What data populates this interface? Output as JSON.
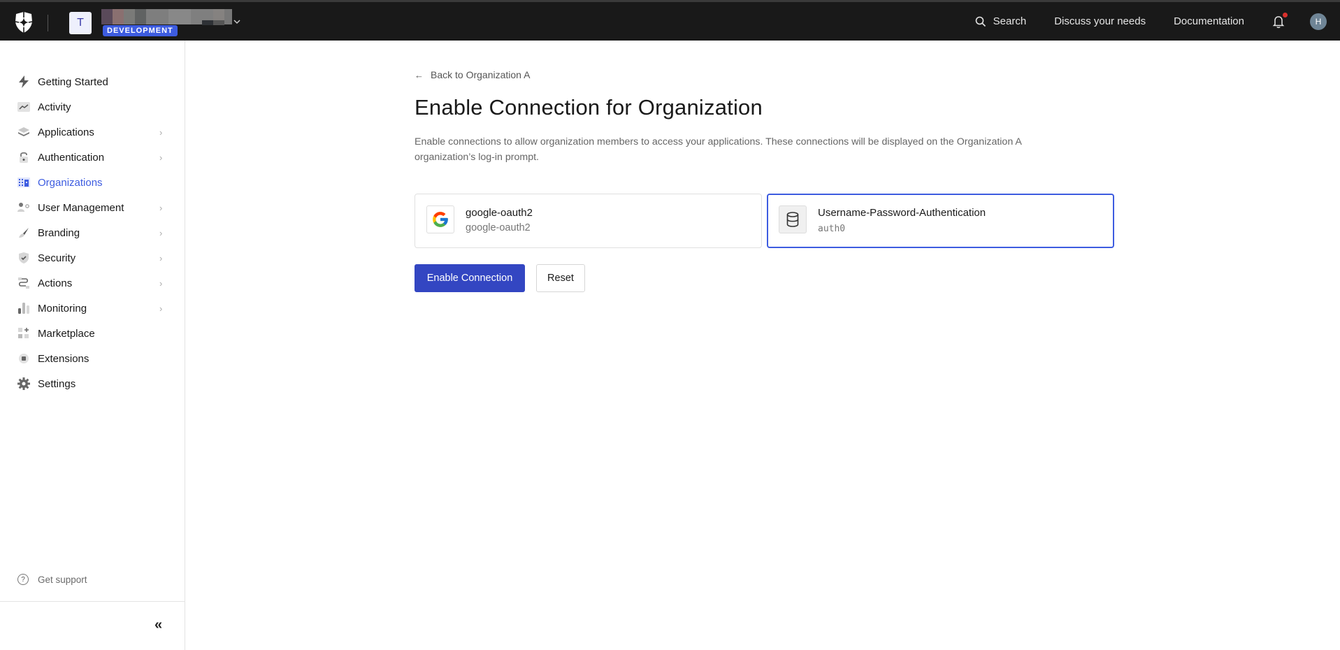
{
  "topbar": {
    "tenant_initial": "T",
    "environment_badge": "DEVELOPMENT",
    "links": {
      "search": "Search",
      "discuss": "Discuss your needs",
      "documentation": "Documentation"
    },
    "avatar_initial": "H",
    "colors": {
      "badge": "#3d5ce0",
      "notification_dot": "#d9302c"
    }
  },
  "sidebar": {
    "items": [
      {
        "label": "Getting Started",
        "icon": "lightning-icon",
        "has_chevron": false
      },
      {
        "label": "Activity",
        "icon": "activity-chart-icon",
        "has_chevron": false
      },
      {
        "label": "Applications",
        "icon": "layers-icon",
        "has_chevron": true
      },
      {
        "label": "Authentication",
        "icon": "lock-icon",
        "has_chevron": true
      },
      {
        "label": "Organizations",
        "icon": "building-icon",
        "has_chevron": false,
        "active": true
      },
      {
        "label": "User Management",
        "icon": "user-gear-icon",
        "has_chevron": true
      },
      {
        "label": "Branding",
        "icon": "brush-icon",
        "has_chevron": true
      },
      {
        "label": "Security",
        "icon": "shield-check-icon",
        "has_chevron": true
      },
      {
        "label": "Actions",
        "icon": "flow-icon",
        "has_chevron": true
      },
      {
        "label": "Monitoring",
        "icon": "bar-chart-icon",
        "has_chevron": true
      },
      {
        "label": "Marketplace",
        "icon": "grid-plus-icon",
        "has_chevron": false
      },
      {
        "label": "Extensions",
        "icon": "chip-icon",
        "has_chevron": false
      },
      {
        "label": "Settings",
        "icon": "gear-icon",
        "has_chevron": false
      }
    ],
    "support_label": "Get support",
    "collapse_glyph": "«",
    "active_color": "#3d5ce0"
  },
  "main": {
    "back_link": "Back to Organization A",
    "title": "Enable Connection for Organization",
    "description": "Enable connections to allow organization members to access your applications. These connections will be displayed on the Organization A organization’s log-in prompt.",
    "connections": [
      {
        "name": "google-oauth2",
        "strategy": "google-oauth2",
        "icon": "google-icon",
        "selected": false
      },
      {
        "name": "Username-Password-Authentication",
        "strategy": "auth0",
        "icon": "database-icon",
        "selected": true
      }
    ],
    "enable_button": "Enable Connection",
    "reset_button": "Reset",
    "colors": {
      "primary_button": "#3346c2",
      "selected_border": "#3d5ce0"
    }
  }
}
